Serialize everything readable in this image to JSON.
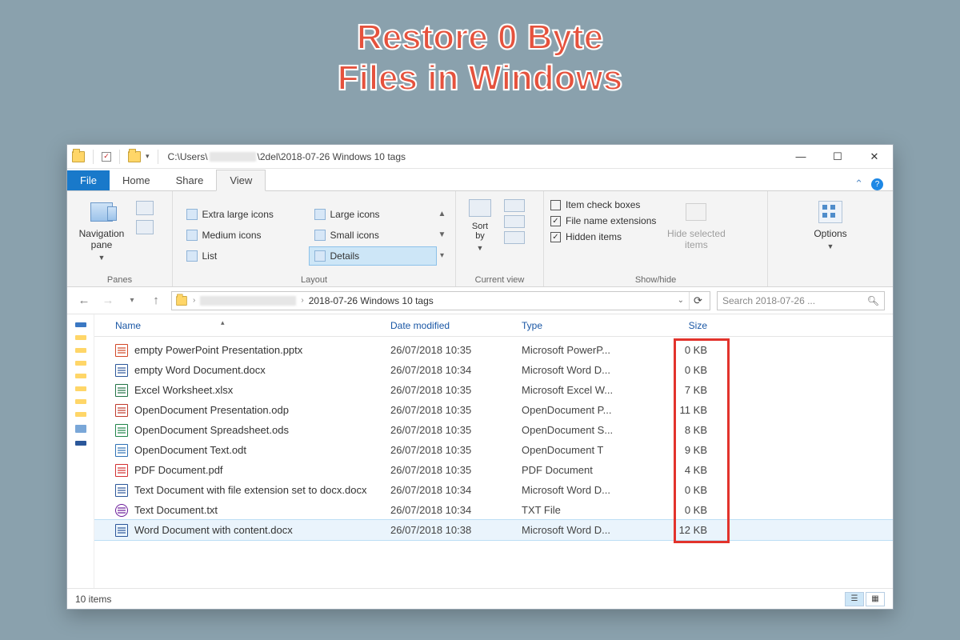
{
  "hero": {
    "line1": "Restore 0 Byte",
    "line2": "Files in Windows"
  },
  "titlebar": {
    "path_prefix": "C:\\Users\\",
    "path_suffix": "\\2del\\2018-07-26 Windows 10 tags"
  },
  "tabs": {
    "file": "File",
    "home": "Home",
    "share": "Share",
    "view": "View"
  },
  "ribbon": {
    "panes": {
      "nav": "Navigation\npane",
      "group": "Panes"
    },
    "layout": {
      "extra_large": "Extra large icons",
      "large": "Large icons",
      "medium": "Medium icons",
      "small": "Small icons",
      "list": "List",
      "details": "Details",
      "group": "Layout"
    },
    "current_view": {
      "sort": "Sort\nby",
      "group": "Current view"
    },
    "show_hide": {
      "item_check": "Item check boxes",
      "ext": "File name extensions",
      "hidden": "Hidden items",
      "hide_sel": "Hide selected\nitems",
      "group": "Show/hide"
    },
    "options": {
      "label": "Options"
    }
  },
  "address": {
    "crumb_current": "2018-07-26 Windows 10 tags",
    "search_placeholder": "Search 2018-07-26 ..."
  },
  "columns": {
    "name": "Name",
    "date": "Date modified",
    "type": "Type",
    "size": "Size"
  },
  "files": [
    {
      "icon": "ico-ppt",
      "name": "empty PowerPoint Presentation.pptx",
      "date": "26/07/2018 10:35",
      "type": "Microsoft PowerP...",
      "size": "0 KB"
    },
    {
      "icon": "ico-doc",
      "name": "empty Word Document.docx",
      "date": "26/07/2018 10:34",
      "type": "Microsoft Word D...",
      "size": "0 KB"
    },
    {
      "icon": "ico-xls",
      "name": "Excel Worksheet.xlsx",
      "date": "26/07/2018 10:35",
      "type": "Microsoft Excel W...",
      "size": "7 KB"
    },
    {
      "icon": "ico-odp",
      "name": "OpenDocument Presentation.odp",
      "date": "26/07/2018 10:35",
      "type": "OpenDocument P...",
      "size": "11 KB"
    },
    {
      "icon": "ico-ods",
      "name": "OpenDocument Spreadsheet.ods",
      "date": "26/07/2018 10:35",
      "type": "OpenDocument S...",
      "size": "8 KB"
    },
    {
      "icon": "ico-odt",
      "name": "OpenDocument Text.odt",
      "date": "26/07/2018 10:35",
      "type": "OpenDocument T",
      "size": "9 KB"
    },
    {
      "icon": "ico-pdf",
      "name": "PDF Document.pdf",
      "date": "26/07/2018 10:35",
      "type": "PDF Document",
      "size": "4 KB"
    },
    {
      "icon": "ico-doc",
      "name": "Text Document with file extension set to docx.docx",
      "date": "26/07/2018 10:34",
      "type": "Microsoft Word D...",
      "size": "0 KB"
    },
    {
      "icon": "ico-txt",
      "name": "Text Document.txt",
      "date": "26/07/2018 10:34",
      "type": "TXT File",
      "size": "0 KB"
    },
    {
      "icon": "ico-doc",
      "name": "Word Document with content.docx",
      "date": "26/07/2018 10:38",
      "type": "Microsoft Word D...",
      "size": "12 KB",
      "selected": true
    }
  ],
  "status": {
    "count": "10 items"
  }
}
